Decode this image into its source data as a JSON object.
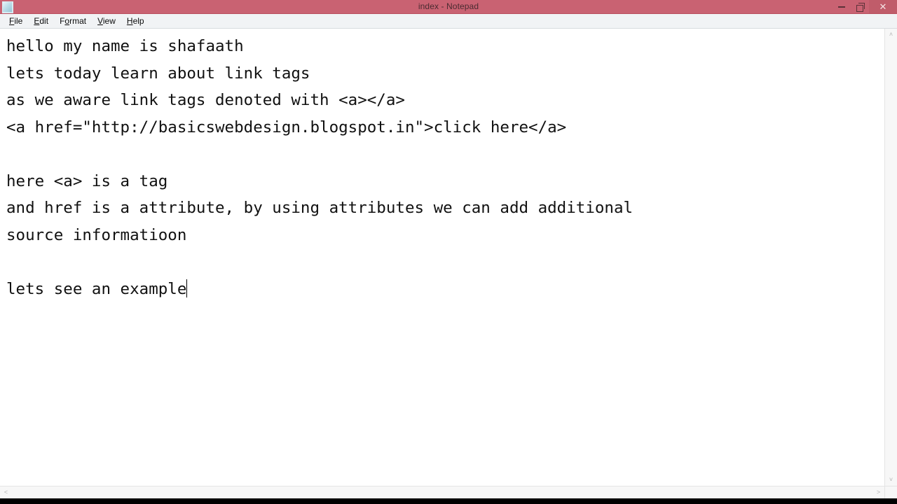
{
  "window": {
    "title": "index - Notepad",
    "icon": "notepad-document-icon",
    "titlebar_color": "#c96272",
    "controls": {
      "minimize_label": "─",
      "restore_label": "❐",
      "close_label": "✕"
    }
  },
  "menubar": {
    "items": [
      {
        "label": "File",
        "accesskey": "F",
        "rest": "ile"
      },
      {
        "label": "Edit",
        "accesskey": "E",
        "rest": "dit"
      },
      {
        "label": "Format",
        "accesskey": "o",
        "pre": "F",
        "rest": "rmat"
      },
      {
        "label": "View",
        "accesskey": "V",
        "rest": "iew"
      },
      {
        "label": "Help",
        "accesskey": "H",
        "rest": "elp"
      }
    ]
  },
  "document": {
    "filename": "index",
    "font": "monospace",
    "text_color": "#111111",
    "background": "#ffffff",
    "lines": [
      "hello my name is shafaath",
      "lets today learn about link tags",
      "as we aware link tags denoted with <a></a>",
      "<a href=\"http://basicswebdesign.blogspot.in\">click here</a>",
      "",
      "here <a> is a tag",
      "and href is a attribute, by using attributes we can add additional",
      "source informatioon",
      "",
      "lets see an example"
    ]
  },
  "scrollbars": {
    "vertical": {
      "up_arrow": "˄",
      "down_arrow": "˅"
    },
    "horizontal": {
      "left_arrow": "˂",
      "right_arrow": "˃"
    }
  }
}
